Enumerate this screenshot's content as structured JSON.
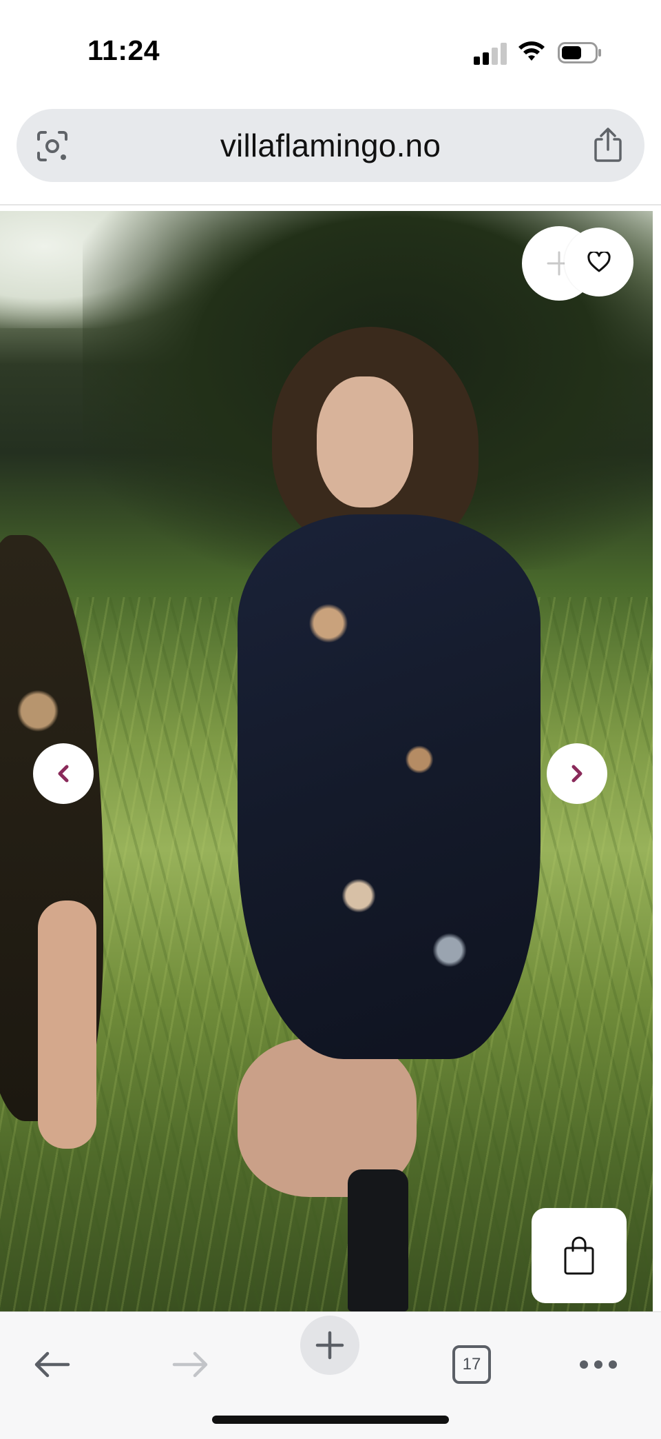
{
  "status_bar": {
    "time": "11:24"
  },
  "browser": {
    "url": "villaflamingo.no",
    "open_tabs_count": "17"
  },
  "product_gallery": {
    "image_description_icon": "product-photo",
    "arrow_color": "#8a2a5a"
  },
  "icons": {
    "lens": "camera-search-icon",
    "share": "share-icon",
    "compare": "plus-icon",
    "wishlist": "heart-icon",
    "prev": "chevron-left-icon",
    "next": "chevron-right-icon",
    "cart": "shopping-bag-icon",
    "back": "arrow-left-icon",
    "forward": "arrow-right-icon",
    "new_tab": "plus-icon",
    "tabs": "tabs-icon",
    "more": "more-horizontal-icon"
  }
}
